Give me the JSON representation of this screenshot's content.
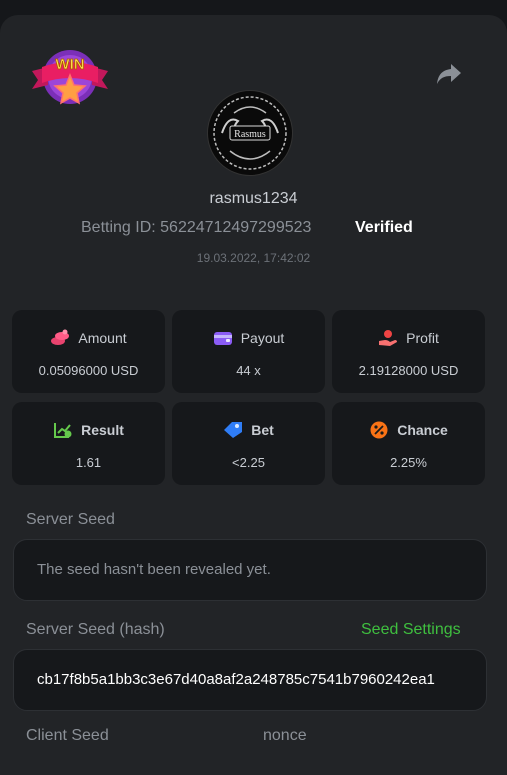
{
  "user": {
    "name": "rasmus1234",
    "betting_id": "Betting ID: 56224712497299523",
    "verified": "Verified",
    "datetime": "19.03.2022, 17:42:02",
    "avatar_text": "Rasmus"
  },
  "badge": {
    "text": "WIN"
  },
  "stats": {
    "amount": {
      "label": "Amount",
      "value": "0.05096000 USD",
      "icon": "coins-icon"
    },
    "payout": {
      "label": "Payout",
      "value": "44 x",
      "icon": "wallet-icon"
    },
    "profit": {
      "label": "Profit",
      "value": "2.19128000 USD",
      "icon": "hand-coin-icon"
    },
    "result": {
      "label": "Result",
      "value": "1.61",
      "icon": "chart-check-icon"
    },
    "bet": {
      "label": "Bet",
      "value": "<2.25",
      "icon": "ticket-icon"
    },
    "chance": {
      "label": "Chance",
      "value": "2.25%",
      "icon": "percent-icon"
    }
  },
  "server_seed": {
    "label": "Server Seed",
    "value": "The seed hasn't been revealed yet."
  },
  "server_seed_hash": {
    "label": "Server Seed (hash)",
    "settings_link": "Seed Settings",
    "value": "cb17f8b5a1bb3c3e67d40a8af2a248785c7541b7960242ea1"
  },
  "client_seed": {
    "label": "Client Seed"
  },
  "nonce": {
    "label": "nonce"
  },
  "colors": {
    "accent_green": "#3fbf3f",
    "panel": "#222427",
    "card": "#16181b"
  }
}
